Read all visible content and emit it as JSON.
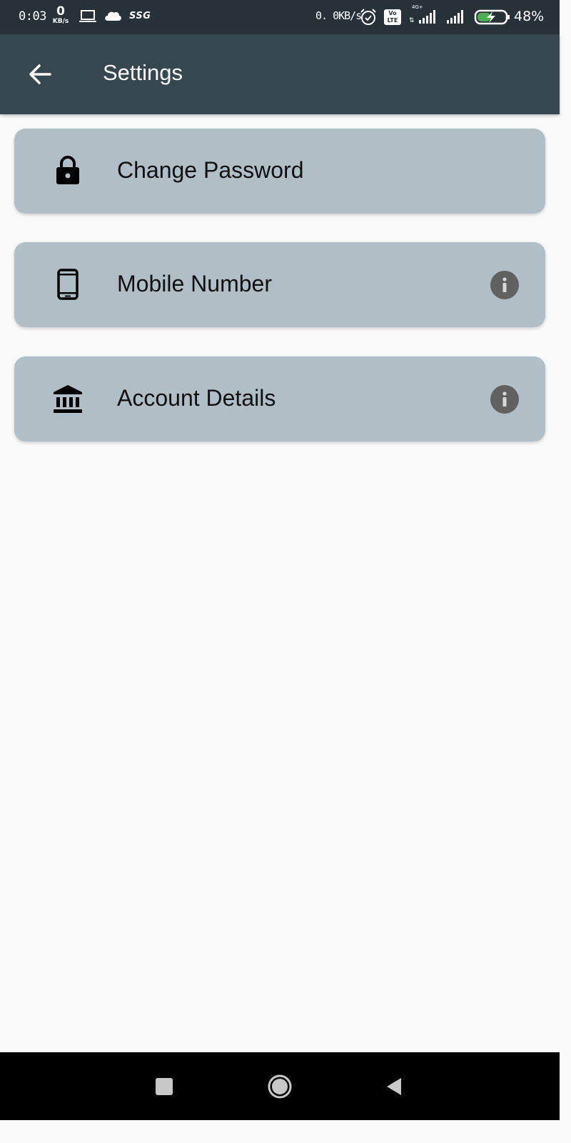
{
  "status_bar": {
    "time": "0:03",
    "net_speed_left_value": "0",
    "net_speed_left_unit": "KB/s",
    "carrier_label": "SSG",
    "net_speed_right": "0. 0KB/s",
    "volte_top": "Vo",
    "volte_bottom": "LTE",
    "network_type": "4G+",
    "battery_percent": "48%",
    "battery_level": 0.48
  },
  "app_bar": {
    "title": "Settings",
    "background_color": "#37474f"
  },
  "settings_items": [
    {
      "label": "Change Password",
      "icon": "lock-icon",
      "has_info": false
    },
    {
      "label": "Mobile Number",
      "icon": "smartphone-icon",
      "has_info": true
    },
    {
      "label": "Account Details",
      "icon": "bank-icon",
      "has_info": true
    }
  ],
  "colors": {
    "card_background": "#b0bec5",
    "status_bar": "#263238",
    "info_icon": "#616161",
    "battery_charge": "#4caf50"
  }
}
